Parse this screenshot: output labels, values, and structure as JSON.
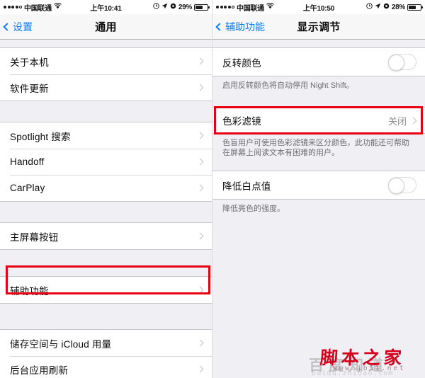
{
  "left_panel": {
    "status_bar": {
      "carrier": "中国联通",
      "signal_dots_filled": 4,
      "signal_dots_total": 5,
      "wifi_icon": "wifi-icon",
      "time": "上午10:41",
      "alarm_icon": "alarm-clock-icon",
      "location_icon": "location-arrow-icon",
      "rotation_lock_icon": "rotation-lock-icon",
      "battery_percent": "29%",
      "battery_icon": "battery-icon"
    },
    "nav": {
      "back_label": "设置",
      "title": "通用",
      "back_icon": "chevron-left-icon"
    },
    "groups": [
      {
        "rows": [
          {
            "label": "关于本机",
            "value": "",
            "accessory": "chevron-right-icon"
          },
          {
            "label": "软件更新",
            "value": "",
            "accessory": "chevron-right-icon"
          }
        ]
      },
      {
        "rows": [
          {
            "label": "Spotlight 搜索",
            "value": "",
            "accessory": "chevron-right-icon"
          },
          {
            "label": "Handoff",
            "value": "",
            "accessory": "chevron-right-icon"
          },
          {
            "label": "CarPlay",
            "value": "",
            "accessory": "chevron-right-icon"
          }
        ]
      },
      {
        "rows": [
          {
            "label": "主屏幕按钮",
            "value": "",
            "accessory": "chevron-right-icon"
          }
        ]
      },
      {
        "rows": [
          {
            "label": "辅助功能",
            "value": "",
            "accessory": "chevron-right-icon"
          }
        ]
      },
      {
        "rows": [
          {
            "label": "储存空间与 iCloud 用量",
            "value": "",
            "accessory": "chevron-right-icon"
          },
          {
            "label": "后台应用刷新",
            "value": "",
            "accessory": "chevron-right-icon"
          }
        ]
      }
    ]
  },
  "right_panel": {
    "status_bar": {
      "carrier": "中国联通",
      "signal_dots_filled": 4,
      "signal_dots_total": 5,
      "wifi_icon": "wifi-icon",
      "time": "上午10:50",
      "alarm_icon": "alarm-clock-icon",
      "location_icon": "location-arrow-icon",
      "rotation_lock_icon": "rotation-lock-icon",
      "battery_percent": "28%",
      "battery_icon": "battery-icon"
    },
    "nav": {
      "back_label": "辅助功能",
      "title": "显示调节",
      "back_icon": "chevron-left-icon"
    },
    "sections": [
      {
        "row": {
          "label": "反转颜色",
          "control": "toggle",
          "toggle_on": false
        },
        "footnote": "启用反转颜色将自动停用 Night Shift。"
      },
      {
        "row": {
          "label": "色彩滤镜",
          "value": "关闭",
          "accessory": "chevron-right-icon"
        },
        "footnote": "色盲用户可使用色彩滤镜来区分颜色，此功能还可帮助在屏幕上阅读文本有困难的用户。"
      },
      {
        "row": {
          "label": "降低白点值",
          "control": "toggle",
          "toggle_on": false
        },
        "footnote": "降低亮色的强度。"
      }
    ]
  },
  "annotations": {
    "highlight_color": "#e60012",
    "boxes": [
      {
        "target": "辅助功能"
      },
      {
        "target": "色彩滤镜"
      }
    ]
  },
  "watermark": {
    "main": "脚本之家",
    "ghost": "百度知道",
    "url": "www.jb51.net",
    "url2": "baidu.zhidao.com"
  }
}
